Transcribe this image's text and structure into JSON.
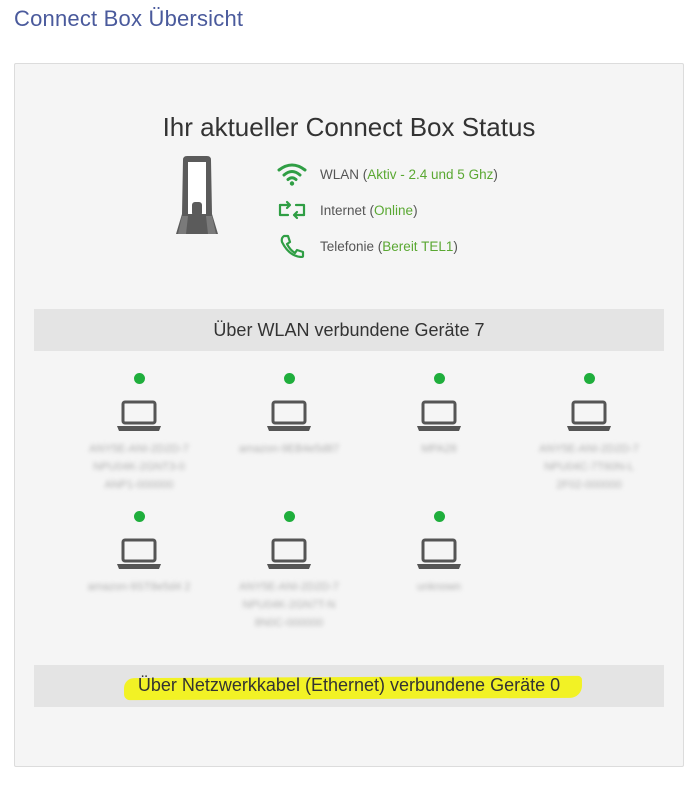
{
  "page": {
    "title": "Connect Box Übersicht"
  },
  "status": {
    "heading": "Ihr aktueller Connect Box Status",
    "rows": [
      {
        "label": "WLAN",
        "value": "Aktiv - 2.4 und 5 Ghz",
        "icon": "wifi-icon"
      },
      {
        "label": "Internet",
        "value": "Online",
        "icon": "internet-icon"
      },
      {
        "label": "Telefonie",
        "value": "Bereit TEL1",
        "icon": "phone-icon"
      }
    ],
    "accent_color": "#5aa832"
  },
  "wlan": {
    "label": "Über WLAN verbundene Geräte 7",
    "devices": [
      {
        "name": "ANY5E-ANI-2D2D-7 NPU04K-2GNT3-0 ANP1-000000"
      },
      {
        "name": "amazon-9EB4e5d87"
      },
      {
        "name": "MPA28"
      },
      {
        "name": "ANY5E-ANI-2D2D-7 NPU04C-7T60N-L 2F02-000000"
      },
      {
        "name": "amazon-9ST8e5d4 2"
      },
      {
        "name": "ANY5E-ANI-2D2D-7 NPU04K-2GN7T-N 8N0C-000000"
      },
      {
        "name": "unknown"
      }
    ],
    "online_color": "#1fae3c"
  },
  "ethernet": {
    "label": "Über Netzwerkkabel (Ethernet) verbundene Geräte 0"
  }
}
